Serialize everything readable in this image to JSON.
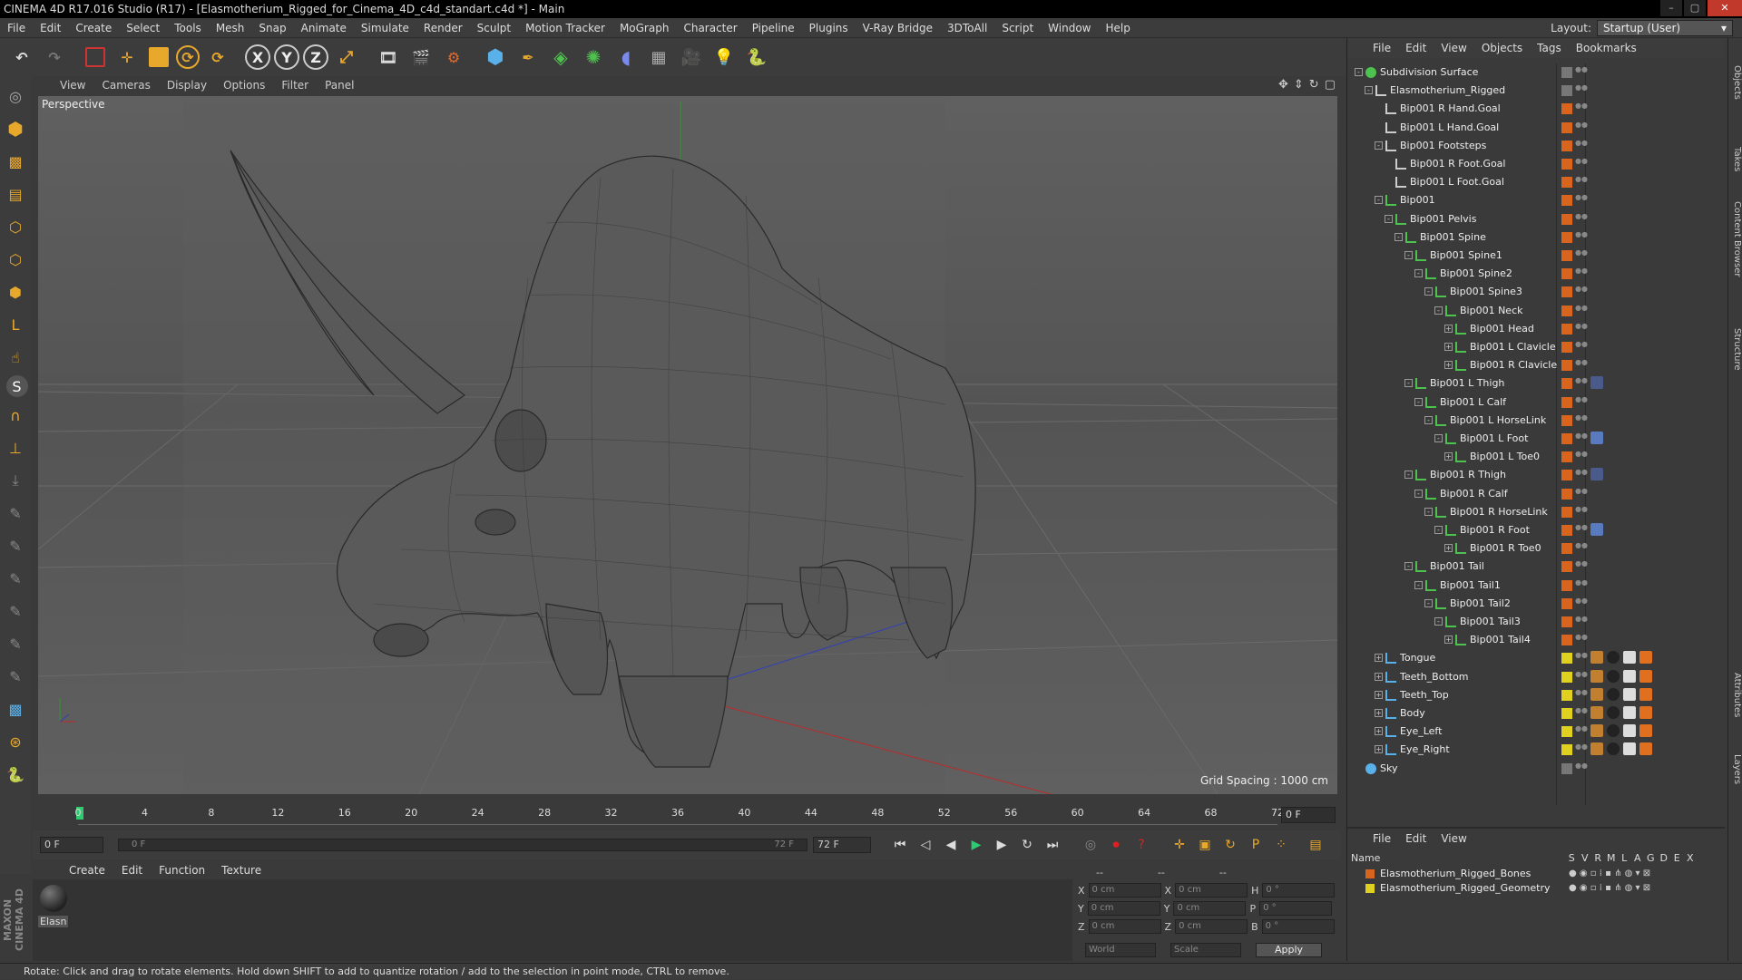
{
  "window": {
    "title": "CINEMA 4D R17.016 Studio (R17) - [Elasmotherium_Rigged_for_Cinema_4D_c4d_standart.c4d *] - Main",
    "layout_label": "Layout:",
    "layout_value": "Startup (User)"
  },
  "menubar": [
    "File",
    "Edit",
    "Create",
    "Select",
    "Tools",
    "Mesh",
    "Snap",
    "Animate",
    "Simulate",
    "Render",
    "Sculpt",
    "Motion Tracker",
    "MoGraph",
    "Character",
    "Pipeline",
    "Plugins",
    "V-Ray Bridge",
    "3DToAll",
    "Script",
    "Window",
    "Help"
  ],
  "toolbar": {
    "undo": "undo-icon",
    "redo": "redo-icon",
    "select": "live-selection-icon",
    "move": "move-icon",
    "scale": "scale-icon",
    "rotate": "rotate-icon",
    "recent": "recent-tool-icon",
    "x": "X",
    "y": "Y",
    "z": "Z",
    "world": "coordinate-system-icon"
  },
  "viewport": {
    "menu": [
      "View",
      "Cameras",
      "Display",
      "Options",
      "Filter",
      "Panel"
    ],
    "label": "Perspective",
    "grid_spacing": "Grid Spacing : 1000 cm"
  },
  "timeline": {
    "ticks": [
      "0",
      "4",
      "8",
      "12",
      "16",
      "20",
      "24",
      "28",
      "32",
      "36",
      "40",
      "44",
      "48",
      "52",
      "56",
      "60",
      "64",
      "68",
      "72"
    ],
    "current_frame": "0 F",
    "start_field": "0 F",
    "range_start": "0 F",
    "range_end": "72 F",
    "end_field": "72 F"
  },
  "material": {
    "menu": [
      "Create",
      "Edit",
      "Function",
      "Texture"
    ],
    "name": "Elasn"
  },
  "coords": {
    "headers": [
      "--",
      "--",
      "--"
    ],
    "rows": [
      {
        "a": "X",
        "av": "0 cm",
        "b": "X",
        "bv": "0 cm",
        "c": "H",
        "cv": "0 °"
      },
      {
        "a": "Y",
        "av": "0 cm",
        "b": "Y",
        "bv": "0 cm",
        "c": "P",
        "cv": "0 °"
      },
      {
        "a": "Z",
        "av": "0 cm",
        "b": "Z",
        "bv": "0 cm",
        "c": "B",
        "cv": "0 °"
      }
    ],
    "space": "World",
    "mode": "Scale",
    "apply": "Apply"
  },
  "status": "Rotate: Click and drag to rotate elements. Hold down SHIFT to add to quantize rotation / add to the selection in point mode, CTRL to remove.",
  "objects_panel": {
    "menu": [
      "File",
      "Edit",
      "View",
      "Objects",
      "Tags",
      "Bookmarks"
    ],
    "items": [
      {
        "name": "Subdivision Surface",
        "depth": 0,
        "kind": "subd",
        "exp": "-",
        "color": "#777777"
      },
      {
        "name": "Elasmotherium_Rigged",
        "depth": 1,
        "kind": "null",
        "exp": "-",
        "color": "#777777"
      },
      {
        "name": "Bip001 R Hand.Goal",
        "depth": 2,
        "kind": "null",
        "exp": "",
        "color": "#d9641e"
      },
      {
        "name": "Bip001 L Hand.Goal",
        "depth": 2,
        "kind": "null",
        "exp": "",
        "color": "#d9641e"
      },
      {
        "name": "Bip001 Footsteps",
        "depth": 2,
        "kind": "null",
        "exp": "-",
        "color": "#d9641e"
      },
      {
        "name": "Bip001 R Foot.Goal",
        "depth": 3,
        "kind": "null",
        "exp": "",
        "color": "#d9641e"
      },
      {
        "name": "Bip001 L Foot.Goal",
        "depth": 3,
        "kind": "null",
        "exp": "",
        "color": "#d9641e"
      },
      {
        "name": "Bip001",
        "depth": 2,
        "kind": "joint",
        "exp": "-",
        "color": "#d9641e"
      },
      {
        "name": "Bip001 Pelvis",
        "depth": 3,
        "kind": "joint",
        "exp": "-",
        "color": "#d9641e"
      },
      {
        "name": "Bip001 Spine",
        "depth": 4,
        "kind": "joint",
        "exp": "-",
        "color": "#d9641e"
      },
      {
        "name": "Bip001 Spine1",
        "depth": 5,
        "kind": "joint",
        "exp": "-",
        "color": "#d9641e"
      },
      {
        "name": "Bip001 Spine2",
        "depth": 6,
        "kind": "joint",
        "exp": "-",
        "color": "#d9641e"
      },
      {
        "name": "Bip001 Spine3",
        "depth": 7,
        "kind": "joint",
        "exp": "-",
        "color": "#d9641e"
      },
      {
        "name": "Bip001 Neck",
        "depth": 8,
        "kind": "joint",
        "exp": "-",
        "color": "#d9641e"
      },
      {
        "name": "Bip001 Head",
        "depth": 9,
        "kind": "joint",
        "exp": "+",
        "color": "#d9641e"
      },
      {
        "name": "Bip001 L Clavicle",
        "depth": 9,
        "kind": "joint",
        "exp": "+",
        "color": "#d9641e"
      },
      {
        "name": "Bip001 R Clavicle",
        "depth": 9,
        "kind": "joint",
        "exp": "+",
        "color": "#d9641e"
      },
      {
        "name": "Bip001 L Thigh",
        "depth": 5,
        "kind": "joint",
        "exp": "-",
        "color": "#d9641e",
        "tag": "ik"
      },
      {
        "name": "Bip001 L Calf",
        "depth": 6,
        "kind": "joint",
        "exp": "-",
        "color": "#d9641e"
      },
      {
        "name": "Bip001 L HorseLink",
        "depth": 7,
        "kind": "joint",
        "exp": "-",
        "color": "#d9641e"
      },
      {
        "name": "Bip001 L Foot",
        "depth": 8,
        "kind": "joint",
        "exp": "-",
        "color": "#d9641e",
        "tag": "ik2"
      },
      {
        "name": "Bip001 L Toe0",
        "depth": 9,
        "kind": "joint",
        "exp": "+",
        "color": "#d9641e"
      },
      {
        "name": "Bip001 R Thigh",
        "depth": 5,
        "kind": "joint",
        "exp": "-",
        "color": "#d9641e",
        "tag": "ik"
      },
      {
        "name": "Bip001 R Calf",
        "depth": 6,
        "kind": "joint",
        "exp": "-",
        "color": "#d9641e"
      },
      {
        "name": "Bip001 R HorseLink",
        "depth": 7,
        "kind": "joint",
        "exp": "-",
        "color": "#d9641e"
      },
      {
        "name": "Bip001 R Foot",
        "depth": 8,
        "kind": "joint",
        "exp": "-",
        "color": "#d9641e",
        "tag": "ik2"
      },
      {
        "name": "Bip001 R Toe0",
        "depth": 9,
        "kind": "joint",
        "exp": "+",
        "color": "#d9641e"
      },
      {
        "name": "Bip001 Tail",
        "depth": 5,
        "kind": "joint",
        "exp": "-",
        "color": "#d9641e"
      },
      {
        "name": "Bip001 Tail1",
        "depth": 6,
        "kind": "joint",
        "exp": "-",
        "color": "#d9641e"
      },
      {
        "name": "Bip001 Tail2",
        "depth": 7,
        "kind": "joint",
        "exp": "-",
        "color": "#d9641e"
      },
      {
        "name": "Bip001 Tail3",
        "depth": 8,
        "kind": "joint",
        "exp": "-",
        "color": "#d9641e"
      },
      {
        "name": "Bip001 Tail4",
        "depth": 9,
        "kind": "joint",
        "exp": "+",
        "color": "#d9641e"
      },
      {
        "name": "Tongue",
        "depth": 2,
        "kind": "mesh",
        "exp": "+",
        "color": "#e0d020",
        "tag": "mat"
      },
      {
        "name": "Teeth_Bottom",
        "depth": 2,
        "kind": "mesh",
        "exp": "+",
        "color": "#e0d020",
        "tag": "mat"
      },
      {
        "name": "Teeth_Top",
        "depth": 2,
        "kind": "mesh",
        "exp": "+",
        "color": "#e0d020",
        "tag": "mat"
      },
      {
        "name": "Body",
        "depth": 2,
        "kind": "mesh",
        "exp": "+",
        "color": "#e0d020",
        "tag": "mat"
      },
      {
        "name": "Eye_Left",
        "depth": 2,
        "kind": "mesh",
        "exp": "+",
        "color": "#e0d020",
        "tag": "mat"
      },
      {
        "name": "Eye_Right",
        "depth": 2,
        "kind": "mesh",
        "exp": "+",
        "color": "#e0d020",
        "tag": "mat"
      },
      {
        "name": "Sky",
        "depth": 0,
        "kind": "sky",
        "exp": "",
        "color": "#777777"
      }
    ]
  },
  "layers_panel": {
    "menu": [
      "File",
      "Edit",
      "View"
    ],
    "columns": [
      "Name",
      "S",
      "V",
      "R",
      "M",
      "L",
      "A",
      "G",
      "D",
      "E",
      "X"
    ],
    "rows": [
      {
        "name": "Elasmotherium_Rigged_Bones",
        "color": "#d9641e"
      },
      {
        "name": "Elasmotherium_Rigged_Geometry",
        "color": "#e0d020"
      }
    ]
  },
  "side_tabs": [
    "Objects",
    "Takes",
    "Content Browser",
    "Structure",
    "Attributes",
    "Layers"
  ],
  "branding": "MAXON CINEMA 4D"
}
